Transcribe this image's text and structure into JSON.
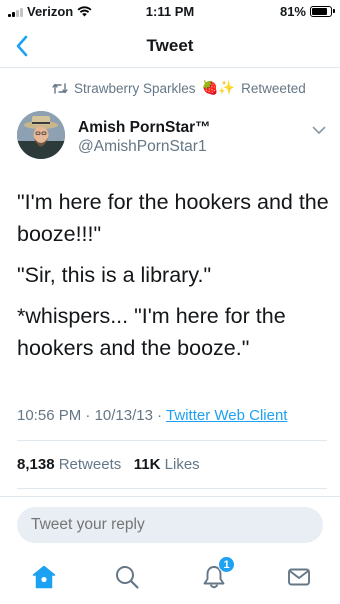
{
  "status_bar": {
    "carrier": "Verizon",
    "time": "1:11 PM",
    "battery": "81%",
    "battery_level": 0.81,
    "signal_bars": 2,
    "signal_bars_total": 4
  },
  "nav": {
    "title": "Tweet",
    "back_icon": "chevron-left-icon"
  },
  "retweet": {
    "user": "Strawberry Sparkles",
    "emojis": "🍓✨",
    "action": "Retweeted"
  },
  "author": {
    "name": "Amish PornStar™",
    "handle": "@AmishPornStar1"
  },
  "tweet": {
    "lines": [
      "\"I'm here for the hookers and the booze!!!\"",
      "\"Sir, this is a library.\"",
      "*whispers... \"I'm here for the hookers and the booze.\""
    ]
  },
  "meta": {
    "time": "10:56 PM",
    "date": "10/13/13",
    "separator": "·",
    "source": "Twitter Web Client"
  },
  "stats": {
    "retweets_count": "8,138",
    "retweets_label": "Retweets",
    "likes_count": "11K",
    "likes_label": "Likes"
  },
  "reply": {
    "placeholder": "Tweet your reply"
  },
  "tab_bar": {
    "notification_count": "1",
    "accent_color": "#1da1f2"
  },
  "colors": {
    "accent": "#1da1f2",
    "muted": "#657786",
    "text": "#14171a",
    "divider": "#e1e8ed"
  }
}
